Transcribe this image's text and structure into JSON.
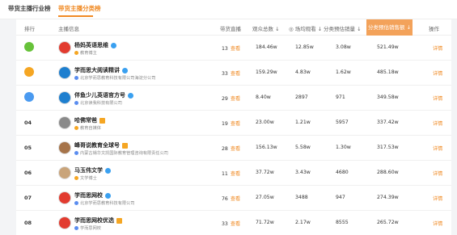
{
  "tabs": [
    "带货主播行业榜",
    "带货主播分类榜"
  ],
  "headers": {
    "rank": "排行",
    "anchor": "主播信息",
    "streams": "带货直播",
    "viewers": "观众总数 ↓",
    "avg_viewers": "◎ 场均观看 ↓",
    "est_sales": "分类预估销量 ↓",
    "est_sales_amount": "分类预估销售额 ↓",
    "action": "操作"
  },
  "look_label": "查看",
  "detail_label": "详情",
  "rows": [
    {
      "rank": "",
      "badge": "#67c23a",
      "name": "杨妈英语思维",
      "sub": "教育博主",
      "streams": "13",
      "viewers": "184.46w",
      "avg": "12.85w",
      "sales": "3.08w",
      "amount": "521.49w"
    },
    {
      "rank": "",
      "badge": "#f5a623",
      "name": "学而思大阅读精讲",
      "sub": "北京学而思教育科技有限公司海淀分公司",
      "streams": "33",
      "viewers": "159.29w",
      "avg": "4.83w",
      "sales": "1.62w",
      "amount": "485.18w"
    },
    {
      "rank": "",
      "badge": "#4a9af0",
      "name": "伴鱼少儿英语官方号",
      "sub": "北京读我科技有限公司",
      "streams": "29",
      "viewers": "8.40w",
      "avg": "2897",
      "sales": "971",
      "amount": "349.58w"
    },
    {
      "rank": "04",
      "badge": "",
      "name": "哈佛常爸",
      "sub": "教育自媒体",
      "streams": "19",
      "viewers": "23.00w",
      "avg": "1.21w",
      "sales": "5957",
      "amount": "337.42w"
    },
    {
      "rank": "05",
      "badge": "",
      "name": "峰哥说教育全球号",
      "sub": "内蒙古锡华文凯国际教育管理咨询有限责任公司",
      "streams": "28",
      "viewers": "156.13w",
      "avg": "5.58w",
      "sales": "1.30w",
      "amount": "317.53w"
    },
    {
      "rank": "06",
      "badge": "",
      "name": "马玉伟文学",
      "sub": "文学博士",
      "streams": "11",
      "viewers": "37.72w",
      "avg": "3.43w",
      "sales": "4680",
      "amount": "288.60w"
    },
    {
      "rank": "07",
      "badge": "",
      "name": "学而思网校",
      "sub": "北京学而思教育科技有限公司",
      "streams": "76",
      "viewers": "27.05w",
      "avg": "3488",
      "sales": "947",
      "amount": "274.39w"
    },
    {
      "rank": "08",
      "badge": "",
      "name": "学而思网校优选",
      "sub": "学而思网校",
      "streams": "33",
      "viewers": "71.72w",
      "avg": "2.17w",
      "sales": "8555",
      "amount": "265.72w"
    }
  ]
}
